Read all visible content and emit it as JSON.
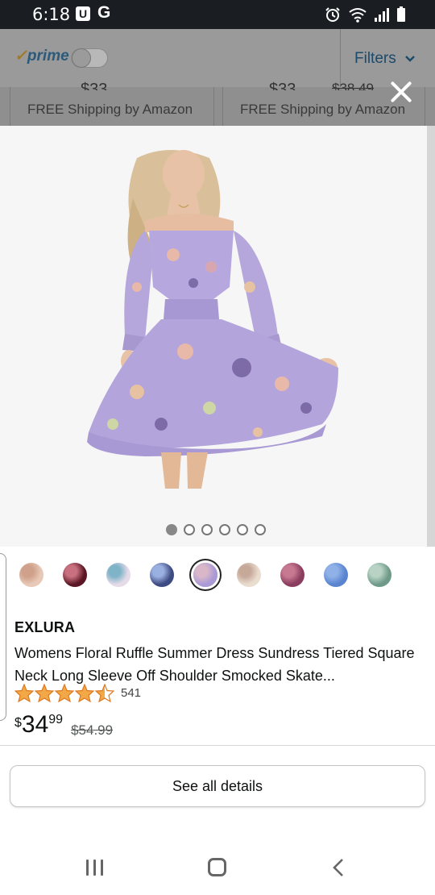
{
  "status_bar": {
    "time": "6:18",
    "badge_u": "U",
    "badge_g": "G"
  },
  "background": {
    "prime_check": "✓",
    "prime_label": "prime",
    "filters_label": "Filters",
    "left_card": {
      "price_fragment": "$33",
      "shipping": "FREE Shipping by Amazon"
    },
    "right_card": {
      "price_fragment": "$33",
      "price_old_fragment": "$38.49",
      "shipping": "FREE Shipping by Amazon"
    }
  },
  "gallery": {
    "image_count": 6,
    "active_index": 0
  },
  "swatches": [
    {
      "color": "#e8c9b8",
      "accent": "#cfa08a"
    },
    {
      "color": "#5a1624",
      "accent": "#c9707f"
    },
    {
      "color": "#e6dbe8",
      "accent": "#7fb3c8"
    },
    {
      "color": "#3e4a82",
      "accent": "#9ab0e0"
    },
    {
      "color": "#a99ad6",
      "accent": "#d9b7c9",
      "selected": true
    },
    {
      "color": "#e9ddd0",
      "accent": "#c7a99a"
    },
    {
      "color": "#8a3d5e",
      "accent": "#c77992"
    },
    {
      "color": "#5a84d0",
      "accent": "#8fb1e8"
    },
    {
      "color": "#6f9a8a",
      "accent": "#b8d3c4"
    }
  ],
  "product": {
    "brand": "EXLURA",
    "title": "Womens Floral Ruffle Summer Dress Sundress Tiered Square Neck Long Sleeve Off Shoulder Smocked Skate...",
    "rating": 4.5,
    "rating_count": "541",
    "price_symbol": "$",
    "price_whole": "34",
    "price_fraction": "99",
    "price_old": "$54.99"
  },
  "details_button": "See all details",
  "colors": {
    "star": "#f3a847",
    "star_outline": "#de7921"
  }
}
